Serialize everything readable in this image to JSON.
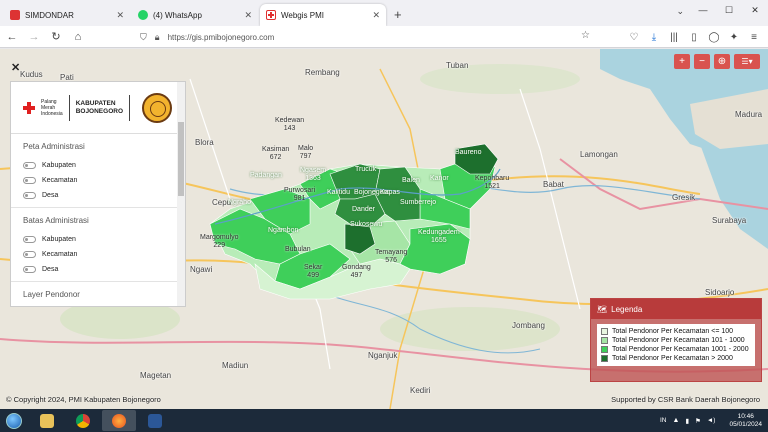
{
  "browser": {
    "tabs": [
      {
        "label": "SIMDONDAR",
        "close": "✕",
        "favicon_color": "#d33"
      },
      {
        "label": "(4) WhatsApp",
        "close": "✕",
        "favicon_color": "#25d366"
      },
      {
        "label": "Webgis PMI",
        "close": "✕",
        "favicon_color": "#e03030"
      }
    ],
    "new_tab": "+",
    "url": "https://gis.pmibojonegoro.com",
    "window_controls": {
      "minimize": "—",
      "maximize": "☐",
      "close": "✕"
    }
  },
  "map_controls": {
    "zoom_in": "+",
    "zoom_out": "−",
    "locate": "⊕",
    "layers": "☰▾"
  },
  "panel": {
    "close": "✕",
    "logo": {
      "pmi_text_1": "Palang",
      "pmi_text_2": "Merah",
      "pmi_text_3": "Indonesia",
      "kab_line_1": "KABUPATEN",
      "kab_line_2": "BOJONEGORO"
    },
    "sections": [
      {
        "title": "Peta Administrasi",
        "options": [
          "Kabupaten",
          "Kecamatan",
          "Desa"
        ]
      },
      {
        "title": "Batas Administrasi",
        "options": [
          "Kabupaten",
          "Kecamatan",
          "Desa"
        ]
      },
      {
        "title": "Layer Pendonor",
        "options": []
      }
    ]
  },
  "map_labels": {
    "cities": [
      "Tuban",
      "Babat",
      "Lamongan",
      "Surabaya",
      "Ngawi",
      "Madiun",
      "Nganjuk",
      "Jombang",
      "Kediri",
      "Magetan",
      "Madura",
      "Sidoarjo",
      "Gresik",
      "Blora",
      "Cepu",
      "Pati",
      "Rembang",
      "Kudus"
    ],
    "kecamatan": [
      {
        "name": "Kasiman",
        "value": "672"
      },
      {
        "name": "Malo",
        "value": "797"
      },
      {
        "name": "Padangan",
        "value": ""
      },
      {
        "name": "Kedewan",
        "value": "143"
      },
      {
        "name": "Purwosari",
        "value": "981"
      },
      {
        "name": "Ngasem",
        "value": "1363"
      },
      {
        "name": "Ngambon",
        "value": ""
      },
      {
        "name": "Margomulyo",
        "value": "229"
      },
      {
        "name": "Ngraho",
        "value": ""
      },
      {
        "name": "Bubulan",
        "value": ""
      },
      {
        "name": "Gondang",
        "value": "497"
      },
      {
        "name": "Sekar",
        "value": "499"
      },
      {
        "name": "Temayang",
        "value": "576"
      },
      {
        "name": "Sukosewu",
        "value": ""
      },
      {
        "name": "Dander",
        "value": ""
      },
      {
        "name": "Kedungadem",
        "value": "1655"
      },
      {
        "name": "Kepohbaru",
        "value": "1521"
      },
      {
        "name": "Baureno",
        "value": ""
      },
      {
        "name": "Trucuk",
        "value": ""
      },
      {
        "name": "Kalitidu",
        "value": ""
      },
      {
        "name": "Bojonegoro",
        "value": ""
      },
      {
        "name": "Kapas",
        "value": ""
      },
      {
        "name": "Balen",
        "value": ""
      },
      {
        "name": "Sumberrejo",
        "value": ""
      },
      {
        "name": "Kanor",
        "value": ""
      }
    ]
  },
  "legend": {
    "title": "Legenda",
    "items": [
      {
        "label": "Total Pendonor Per Kecamatan <= 100",
        "color": "#e8f5e0"
      },
      {
        "label": "Total Pendonor Per Kecamatan 101 - 1000",
        "color": "#a6e5a6"
      },
      {
        "label": "Total Pendonor Per Kecamatan 1001 - 2000",
        "color": "#3fcf5a"
      },
      {
        "label": "Total Pendonor Per Kecamatan > 2000",
        "color": "#1d6f2d"
      }
    ]
  },
  "attribution": {
    "left": "© Copyright 2024, PMI Kabupaten Bojonegoro",
    "right": "Supported by CSR Bank Daerah Bojonegoro"
  },
  "taskbar": {
    "lang": "IN",
    "time": "10:46",
    "date": "05/01/2024"
  }
}
